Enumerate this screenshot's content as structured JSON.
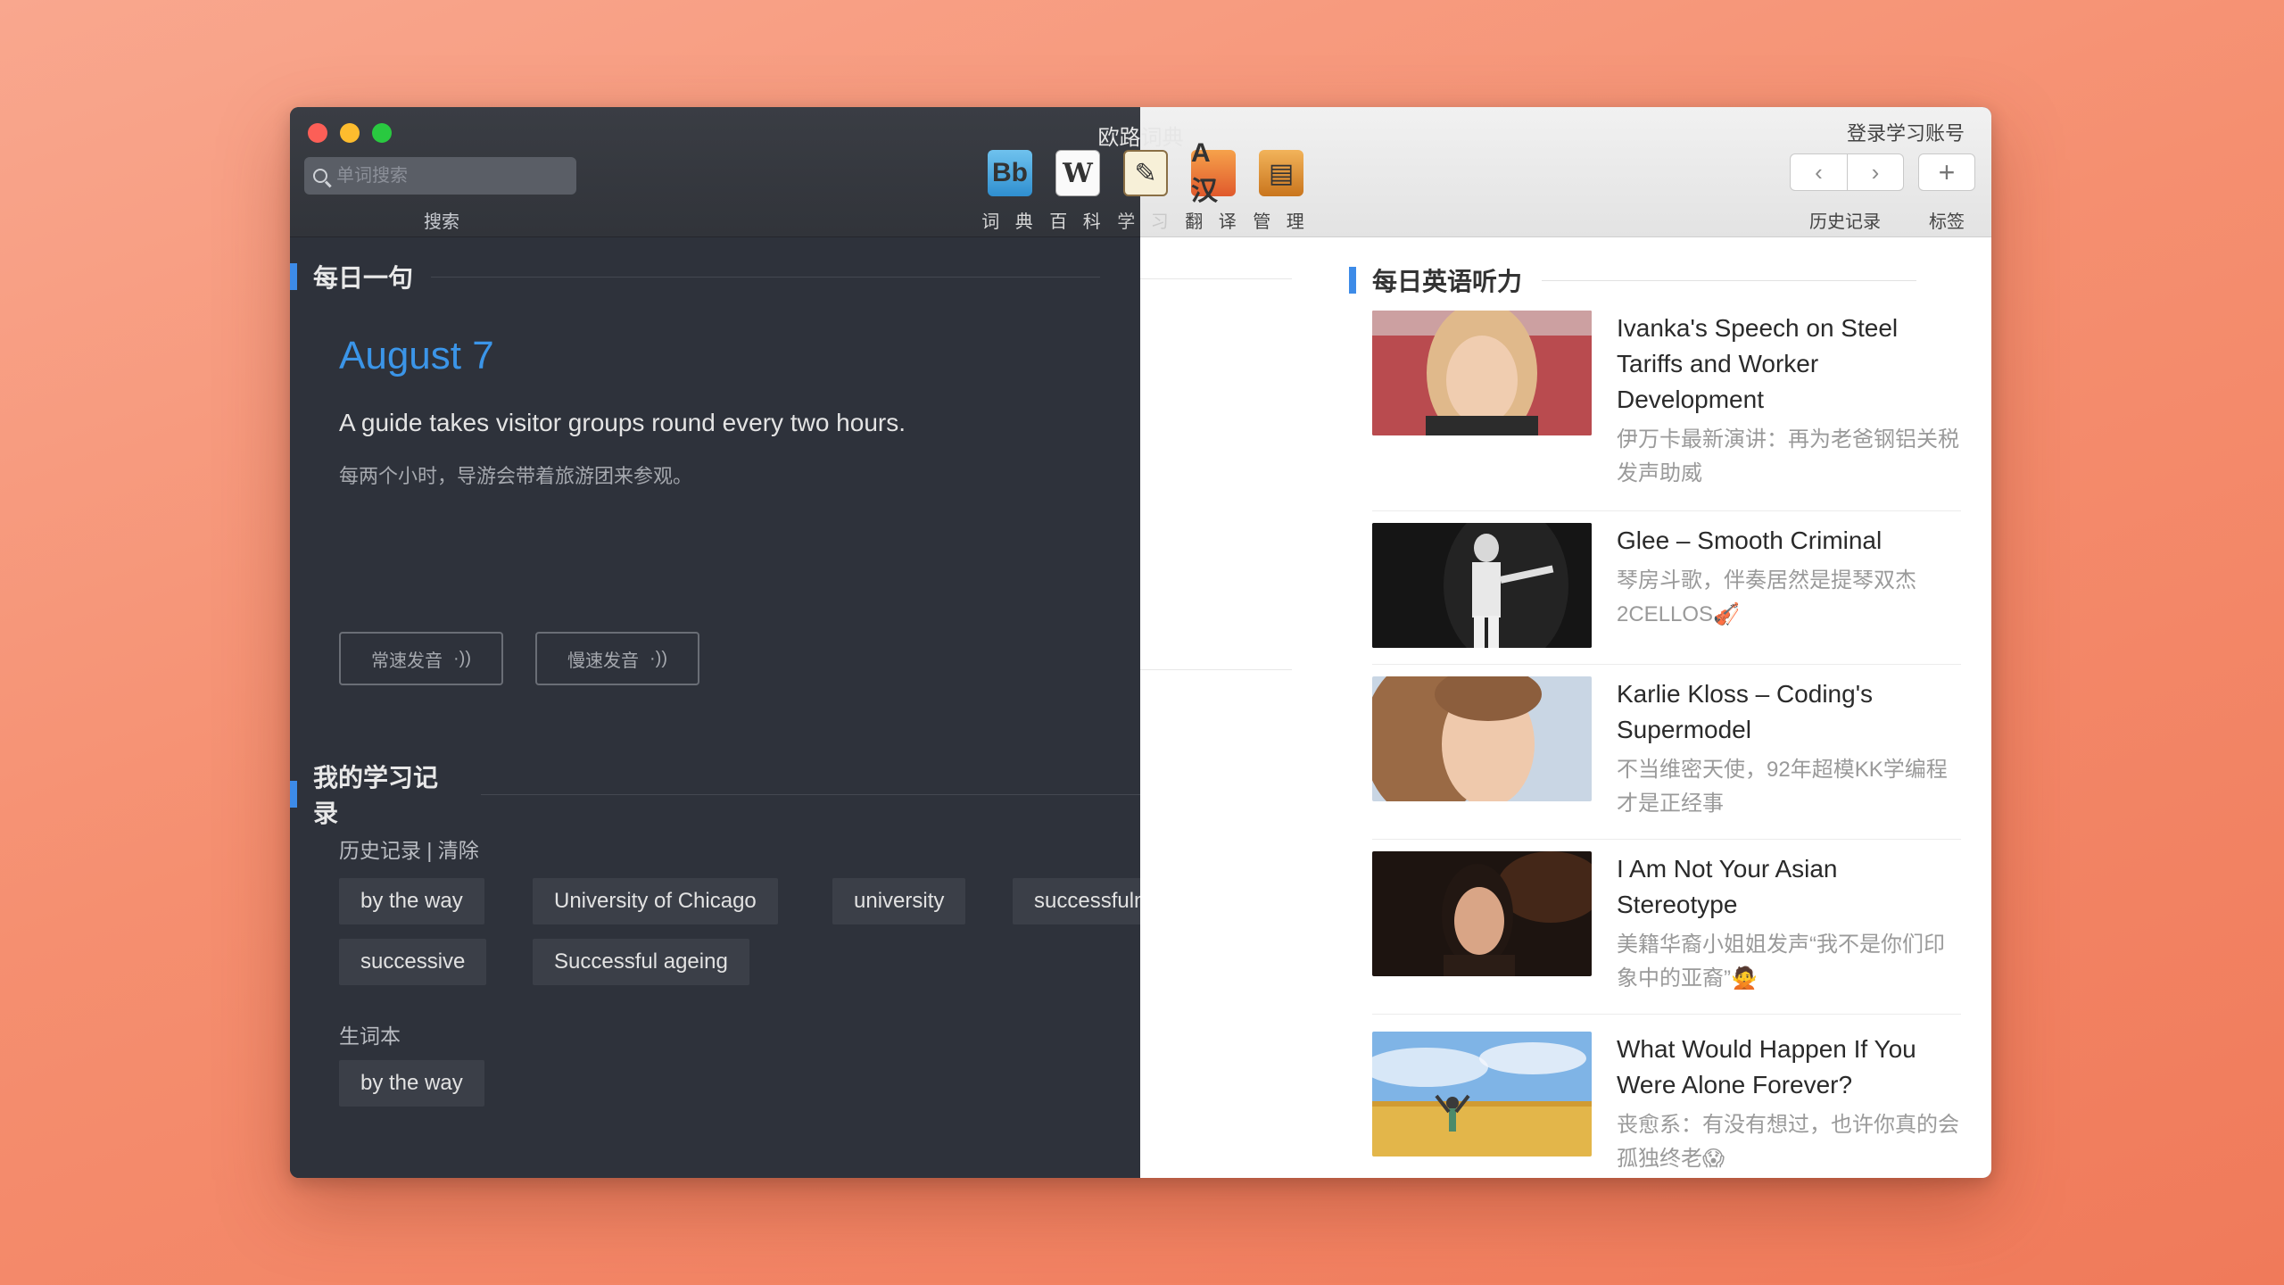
{
  "window": {
    "title": "欧路词典"
  },
  "toolbar": {
    "search_placeholder": "单词搜索",
    "search_label": "搜索",
    "tools": [
      {
        "label": "词 典",
        "icon": "dictionary-icon",
        "glyph": "Bb"
      },
      {
        "label": "百 科",
        "icon": "wikipedia-icon",
        "glyph": "W"
      },
      {
        "label": "学 习",
        "icon": "study-notebook-icon",
        "glyph": "✎"
      },
      {
        "label": "翻 译",
        "icon": "translate-icon",
        "glyph": "A汉"
      },
      {
        "label": "管 理",
        "icon": "manage-box-icon",
        "glyph": "▤"
      }
    ],
    "login_label": "登录学习账号",
    "back_glyph": "‹",
    "forward_glyph": "›",
    "add_glyph": "+",
    "history_label": "历史记录",
    "tags_label": "标签"
  },
  "daily_sentence": {
    "heading": "每日一句",
    "date": "August 7",
    "sentence": "A guide takes visitor groups round every two hours.",
    "translation": "每两个小时，导游会带着旅游团来参观。",
    "normal_speed_label": "常速发音",
    "slow_speed_label": "慢速发音",
    "speaker_glyph": "·))"
  },
  "study_record": {
    "heading": "我的学习记录",
    "history_clear_label": "历史记录 | 清除",
    "history_chips": [
      "by the way",
      "University of Chicago",
      "university",
      "successfulness",
      "successive",
      "Successful ageing"
    ],
    "vocab_label": "生词本",
    "vocab_chips": [
      "by the way"
    ]
  },
  "listening": {
    "heading": "每日英语听力",
    "articles": [
      {
        "title": "Ivanka's Speech on Steel Tariffs and Worker Development",
        "subtitle": "伊万卡最新演讲：再为老爸钢铝关税发声助威"
      },
      {
        "title": "Glee – Smooth Criminal",
        "subtitle": "琴房斗歌，伴奏居然是提琴双杰2CELLOS🎻"
      },
      {
        "title": "Karlie Kloss – Coding's Supermodel",
        "subtitle": "不当维密天使，92年超模KK学编程才是正经事"
      },
      {
        "title": "I Am Not Your Asian Stereotype",
        "subtitle": "美籍华裔小姐姐发声“我不是你们印象中的亚裔”🙅"
      },
      {
        "title": "What Would Happen If You Were Alone Forever?",
        "subtitle": "丧愈系：有没有想过，也许你真的会孤独终老😱"
      }
    ]
  }
}
